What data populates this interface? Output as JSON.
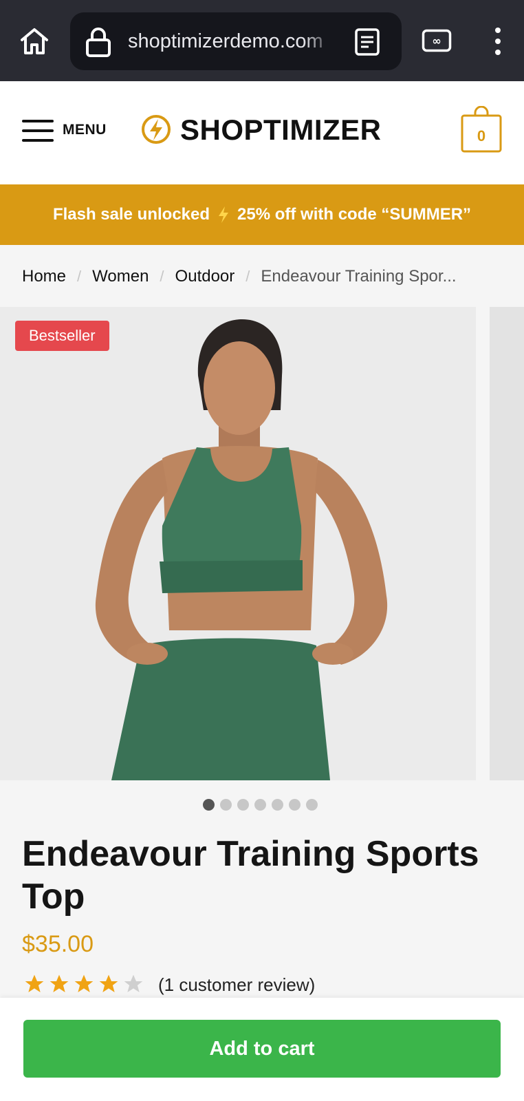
{
  "browser": {
    "url": "shoptimizerdemo.com",
    "icons": [
      "home-icon",
      "lock-icon",
      "reader-mode-icon",
      "tab-switcher-icon",
      "more-options-icon"
    ]
  },
  "header": {
    "menu_label": "MENU",
    "logo_text": "SHOPTIMIZER",
    "cart_count": "0",
    "brand_color": "#d99a14"
  },
  "promo": {
    "text_left": "Flash sale unlocked",
    "text_right": "25% off with code “SUMMER”",
    "background": "#d99a14"
  },
  "breadcrumb": {
    "items": [
      "Home",
      "Women",
      "Outdoor"
    ],
    "current": "Endeavour Training Spor..."
  },
  "gallery": {
    "badge": "Bestseller",
    "badge_color": "#e5484d",
    "active_slide": 1,
    "slide_count": 7
  },
  "product": {
    "title": "Endeavour Training Sports Top",
    "price": "$35.00",
    "rating": 4,
    "rating_max": 5,
    "review_text": "(1 customer review)"
  },
  "sticky_bar": {
    "add_to_cart_label": "Add to cart",
    "button_color": "#3bb54a"
  }
}
